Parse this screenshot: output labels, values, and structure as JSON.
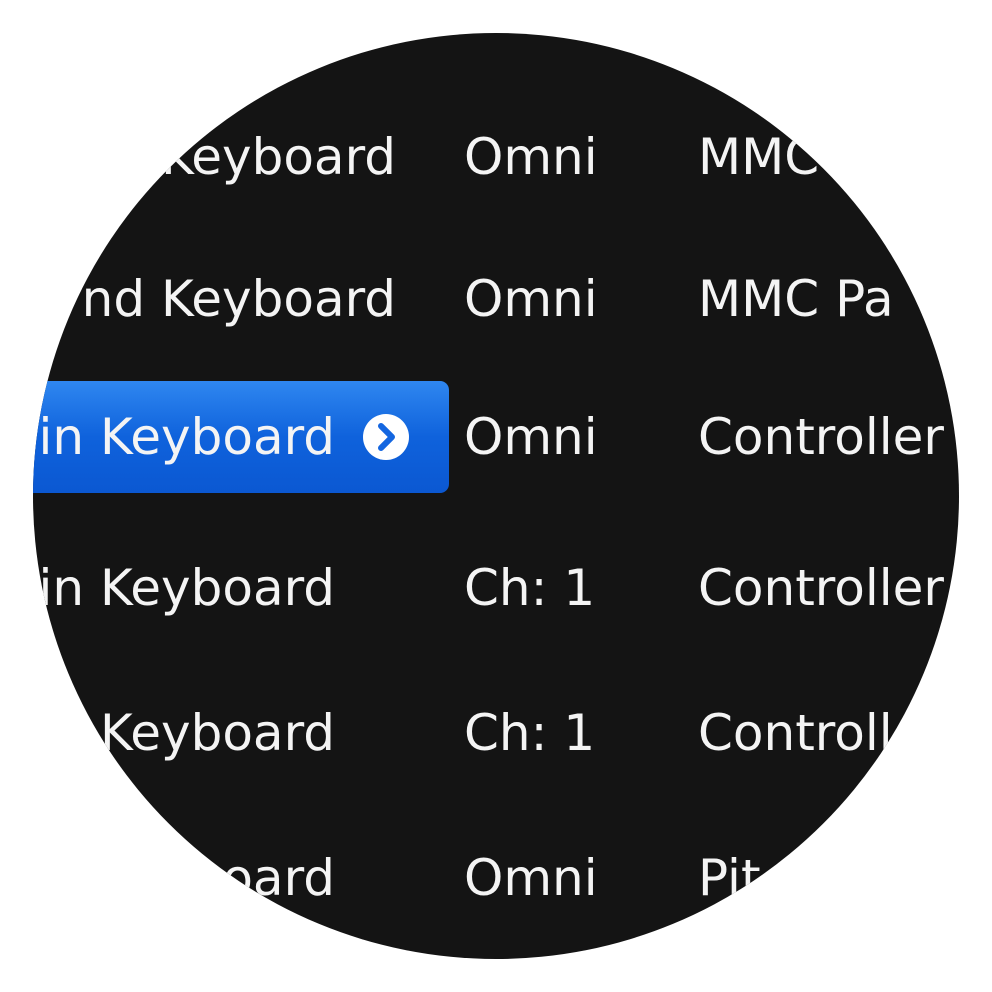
{
  "rows": [
    {
      "name": "Keyboard",
      "channel": "Omni",
      "type": "MMC"
    },
    {
      "name": "nd Keyboard",
      "channel": "Omni",
      "type": "MMC Pa"
    },
    {
      "name": "in Keyboard",
      "channel": "Omni",
      "type": "Controller"
    },
    {
      "name": "in Keyboard",
      "channel": "Ch: 1",
      "type": "Controller"
    },
    {
      "name": "Keyboard",
      "channel": "Ch: 1",
      "type": "Controll"
    },
    {
      "name": "oard",
      "channel": "Omni",
      "type": "Pit"
    }
  ],
  "selected_row_index": 2,
  "colors": {
    "background": "#141414",
    "text": "#f4f4f4",
    "selection": "#1466e0",
    "frame": "#ffffff"
  },
  "icons": {
    "disclosure": "chevron-right-circle-icon"
  }
}
